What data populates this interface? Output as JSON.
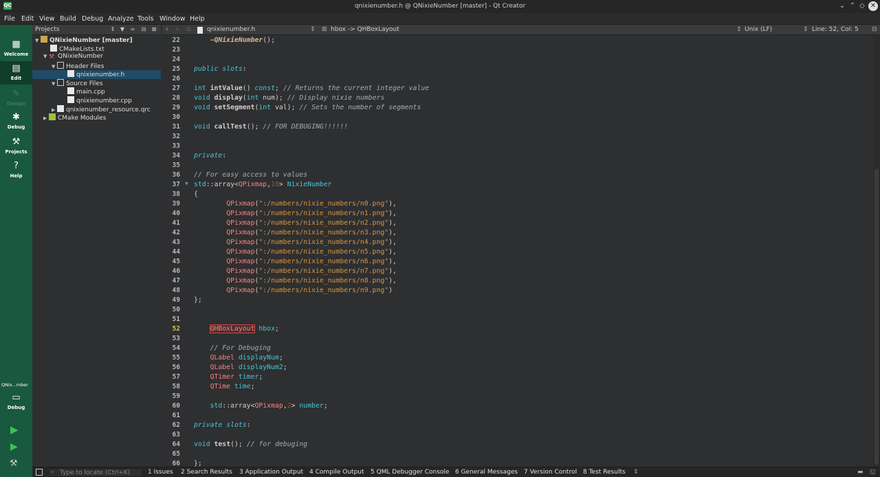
{
  "window": {
    "title": "qnixienumber.h @ QNixieNumber [master] - Qt Creator"
  },
  "menu": [
    "File",
    "Edit",
    "View",
    "Build",
    "Debug",
    "Analyze",
    "Tools",
    "Window",
    "Help"
  ],
  "modes": {
    "welcome": "Welcome",
    "edit": "Edit",
    "design": "Design",
    "debug": "Debug",
    "projects": "Projects",
    "help": "Help",
    "target_project": "QNix...mber",
    "target_config": "Debug"
  },
  "projects": {
    "header": "Projects",
    "tree": [
      {
        "label": "QNixieNumber [master]"
      },
      {
        "label": "CMakeLists.txt"
      },
      {
        "label": "QNixieNumber"
      },
      {
        "label": "Header Files"
      },
      {
        "label": "qnixienumber.h"
      },
      {
        "label": "Source Files"
      },
      {
        "label": "main.cpp"
      },
      {
        "label": "qnixienumber.cpp"
      },
      {
        "label": "qnixienumber_resource.qrc"
      },
      {
        "label": "CMake Modules"
      }
    ]
  },
  "editor": {
    "file": "qnixienumber.h",
    "symbol": "hbox -> QHBoxLayout",
    "line_endings": "Unix (LF)",
    "position": "Line: 52, Col: 5",
    "current_line": "52",
    "line_numbers": [
      "22",
      "23",
      "24",
      "25",
      "26",
      "27",
      "28",
      "29",
      "30",
      "31",
      "32",
      "33",
      "34",
      "35",
      "36",
      "37",
      "38",
      "39",
      "40",
      "41",
      "42",
      "43",
      "44",
      "45",
      "46",
      "47",
      "48",
      "49",
      "50",
      "51",
      "52",
      "53",
      "54",
      "55",
      "56",
      "57",
      "58",
      "59",
      "60",
      "61",
      "62",
      "63",
      "64",
      "65",
      "66"
    ]
  },
  "code": {
    "l22": "~QNixieNumber",
    "l22b": "();",
    "public": "public",
    "slots": "slots",
    "colon": ":",
    "l27a": "int",
    "l27b": "intValue",
    "l27c": "()",
    "l27d": "const",
    "l27e": ";",
    "l27f": "// Returns the current integer value",
    "l28a": "void",
    "l28b": "display",
    "l28c": "(",
    "l28d": "int",
    "l28e": " num);",
    "l28f": "// Display nixie numbers",
    "l29a": "void",
    "l29b": "setSegment",
    "l29c": "(",
    "l29d": "int",
    "l29e": " val);",
    "l29f": "// Sets the number of segments",
    "l31a": "void",
    "l31b": "callTest",
    "l31c": "();",
    "l31d": "// FOR DEBUGING!!!!!!",
    "private": "private",
    "l36": "// For easy access to values",
    "l37a": "std",
    "l37b": "::array<",
    "l37c": "QPixmap",
    "l37d": ",",
    "l37e": "10",
    "l37f": ">",
    "l37g": "NixieNumber",
    "brace_open": "{",
    "qpixmap": "QPixmap",
    "paths": [
      "\":/numbers/nixie_numbers/n0.png\"",
      "\":/numbers/nixie_numbers/n1.png\"",
      "\":/numbers/nixie_numbers/n2.png\"",
      "\":/numbers/nixie_numbers/n3.png\"",
      "\":/numbers/nixie_numbers/n4.png\"",
      "\":/numbers/nixie_numbers/n5.png\"",
      "\":/numbers/nixie_numbers/n6.png\"",
      "\":/numbers/nixie_numbers/n7.png\"",
      "\":/numbers/nixie_numbers/n8.png\"",
      "\":/numbers/nixie_numbers/n9.png\""
    ],
    "l49": "};",
    "l52a": "QHBoxLayout",
    "l52b": "hbox",
    "l52c": ";",
    "l54": "// For Debuging",
    "l55a": "QLabel",
    "l55b": "displayNum",
    "l56b": "displayNum2",
    "l57a": "QTimer",
    "l57b": "timer",
    "l58a": "QTime",
    "l58b": "time",
    "l60g": "number",
    "l60e": "2",
    "l64a": "void",
    "l64b": "test",
    "l64c": "();",
    "l64d": "// for debuging",
    "l66": "};"
  },
  "statusbar": {
    "locator_placeholder": "Type to locate (Ctrl+K)",
    "tabs": [
      "1  Issues",
      "2  Search Results",
      "3  Application Output",
      "4  Compile Output",
      "5  QML Debugger Console",
      "6  General Messages",
      "7  Version Control",
      "8  Test Results"
    ]
  }
}
